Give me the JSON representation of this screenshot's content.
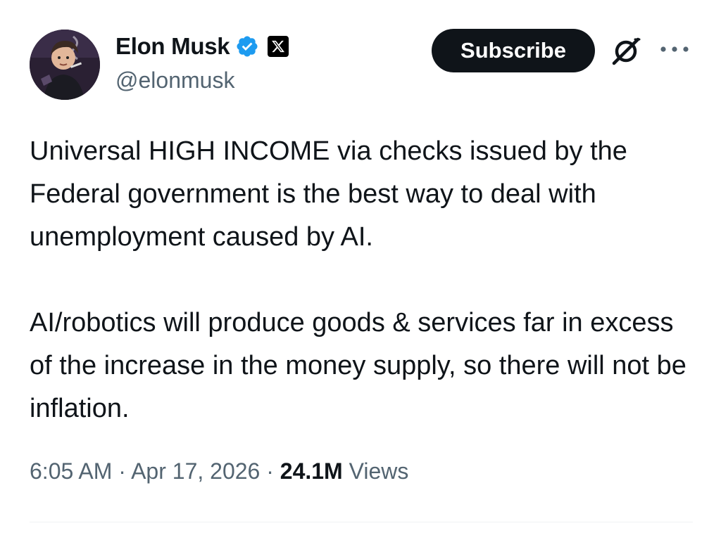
{
  "author": {
    "display_name": "Elon Musk",
    "handle": "@elonmusk",
    "verified_icon": "verified-badge-icon",
    "affiliation_icon": "x-logo-icon",
    "avatar_icon": "avatar-image"
  },
  "actions": {
    "subscribe_label": "Subscribe",
    "grok_icon": "grok-icon",
    "more_icon": "more-options-icon"
  },
  "tweet": {
    "paragraphs": [
      "Universal HIGH INCOME via checks issued by the Federal government is the best way to deal with unemployment caused by AI.",
      "AI/robotics will produce goods & services far in excess of the increase in the money supply, so there will not be inflation."
    ]
  },
  "meta": {
    "time": "6:05 AM",
    "separator": "·",
    "date": "Apr 17, 2026",
    "views_count": "24.1M",
    "views_label": "Views"
  },
  "colors": {
    "text_primary": "#0f1419",
    "text_secondary": "#536471",
    "verified_blue": "#1d9bf0",
    "button_bg": "#0f1419"
  }
}
